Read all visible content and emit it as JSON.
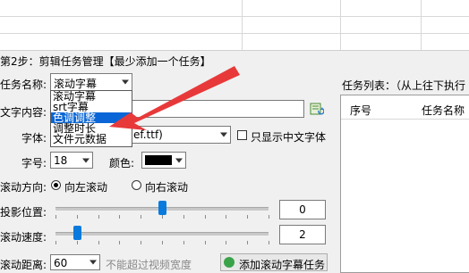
{
  "step": {
    "title": "第2步：剪辑任务管理【最少添加一个任务】"
  },
  "form": {
    "task_name_label": "任务名称:",
    "task_name_value": "滚动字幕",
    "text_content_label": "文字内容:",
    "font_label": "字体:",
    "font_value": "ef.ttf)",
    "chinese_only_label": "只显示中文字体",
    "size_label": "字号:",
    "size_value": "18",
    "color_label": "颜色:",
    "color_value": "#000000",
    "direction_label": "滚动方向:",
    "direction_left": "向左滚动",
    "direction_right": "向右滚动",
    "direction_selected": "left",
    "position_label": "投影位置:",
    "position_value": "0",
    "position_level": 0.5,
    "speed_label": "滚动速度:",
    "speed_value": "2",
    "speed_level": 0.1,
    "distance_label": "滚动距离:",
    "distance_value": "60",
    "distance_note": "不能超过视频宽度",
    "add_button_label": "添加滚动字幕任务"
  },
  "dropdown": {
    "options": [
      "滚动字幕",
      "srt字幕",
      "色调调整",
      "调整时长",
      "文件元数据"
    ],
    "selected_index": 2
  },
  "task_list": {
    "title": "任务列表：（从上往下执行",
    "columns": [
      "序号",
      "任务名称"
    ]
  },
  "annotation": {
    "arrow_color": "#e8393a"
  }
}
